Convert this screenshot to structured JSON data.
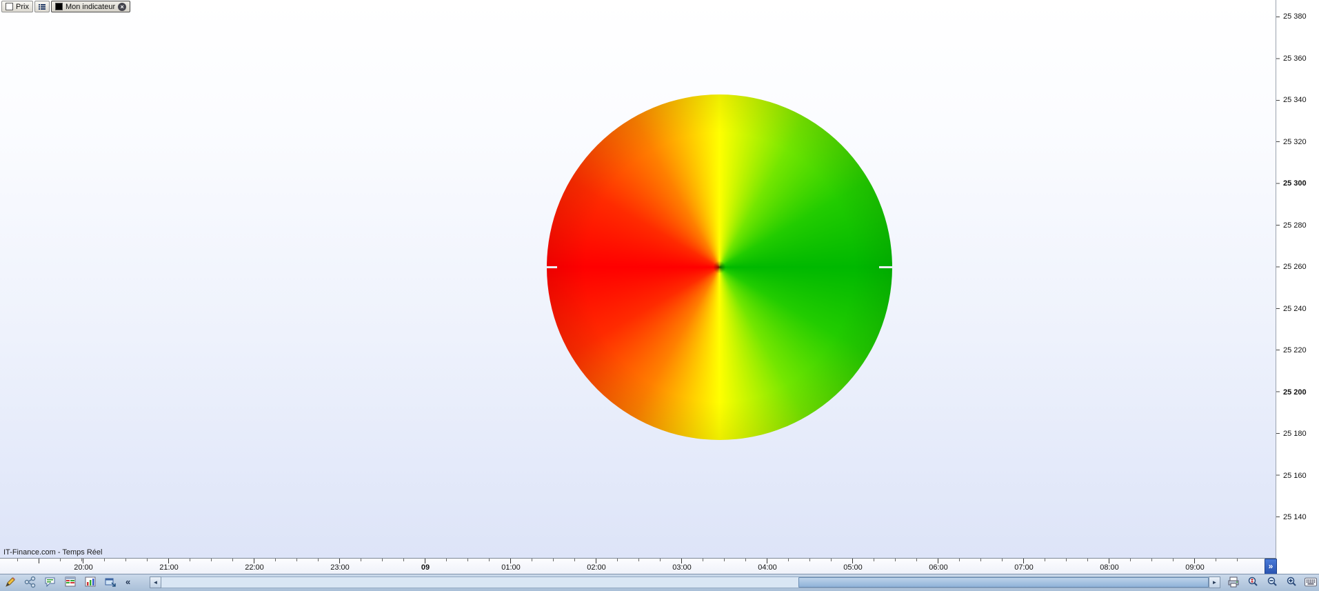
{
  "tab_bar": {
    "price_tab_label": "Prix",
    "indicator_tab_label": "Mon indicateur",
    "close_glyph": "×",
    "icons": [
      "price-swatch-icon",
      "tab-list-icon",
      "indicator-swatch-icon",
      "close-icon"
    ]
  },
  "chart": {
    "watermark": "IT-Finance.com - Temps Réel",
    "background_top": "#ffffff",
    "background_bottom": "#dde4f8"
  },
  "indicator_wheel": {
    "type": "conic-color-wheel",
    "colors": {
      "left": "#ff0000",
      "top": "#ffff00",
      "bottom": "#ffff00",
      "right": "#00b800"
    }
  },
  "price_axis": {
    "labels": [
      {
        "text": "25 380",
        "bold": false
      },
      {
        "text": "25 360",
        "bold": false
      },
      {
        "text": "25 340",
        "bold": false
      },
      {
        "text": "25 320",
        "bold": false
      },
      {
        "text": "25 300",
        "bold": true
      },
      {
        "text": "25 280",
        "bold": false
      },
      {
        "text": "25 260",
        "bold": false
      },
      {
        "text": "25 240",
        "bold": false
      },
      {
        "text": "25 220",
        "bold": false
      },
      {
        "text": "25 200",
        "bold": true
      },
      {
        "text": "25 180",
        "bold": false
      },
      {
        "text": "25 160",
        "bold": false
      },
      {
        "text": "25 140",
        "bold": false
      }
    ]
  },
  "time_axis": {
    "labels": [
      {
        "text": "20:00",
        "bold": false
      },
      {
        "text": "21:00",
        "bold": false
      },
      {
        "text": "22:00",
        "bold": false
      },
      {
        "text": "23:00",
        "bold": false
      },
      {
        "text": "09",
        "bold": true
      },
      {
        "text": "01:00",
        "bold": false
      },
      {
        "text": "02:00",
        "bold": false
      },
      {
        "text": "03:00",
        "bold": false
      },
      {
        "text": "04:00",
        "bold": false
      },
      {
        "text": "05:00",
        "bold": false
      },
      {
        "text": "06:00",
        "bold": false
      },
      {
        "text": "07:00",
        "bold": false
      },
      {
        "text": "08:00",
        "bold": false
      },
      {
        "text": "09:00",
        "bold": false
      }
    ],
    "more_button_label": "»"
  },
  "status_bar": {
    "collapse_label": "«",
    "scroll_left_glyph": "◄",
    "scroll_right_glyph": "►",
    "left_icons": [
      "draw-tools-icon",
      "share-icon",
      "chat-icon",
      "portfolio-icon",
      "chart-bars-icon",
      "detach-window-icon"
    ],
    "right_icons": [
      "print-icon",
      "zoom-vertical-icon",
      "zoom-out-icon",
      "zoom-in-icon",
      "keyboard-icon"
    ]
  }
}
